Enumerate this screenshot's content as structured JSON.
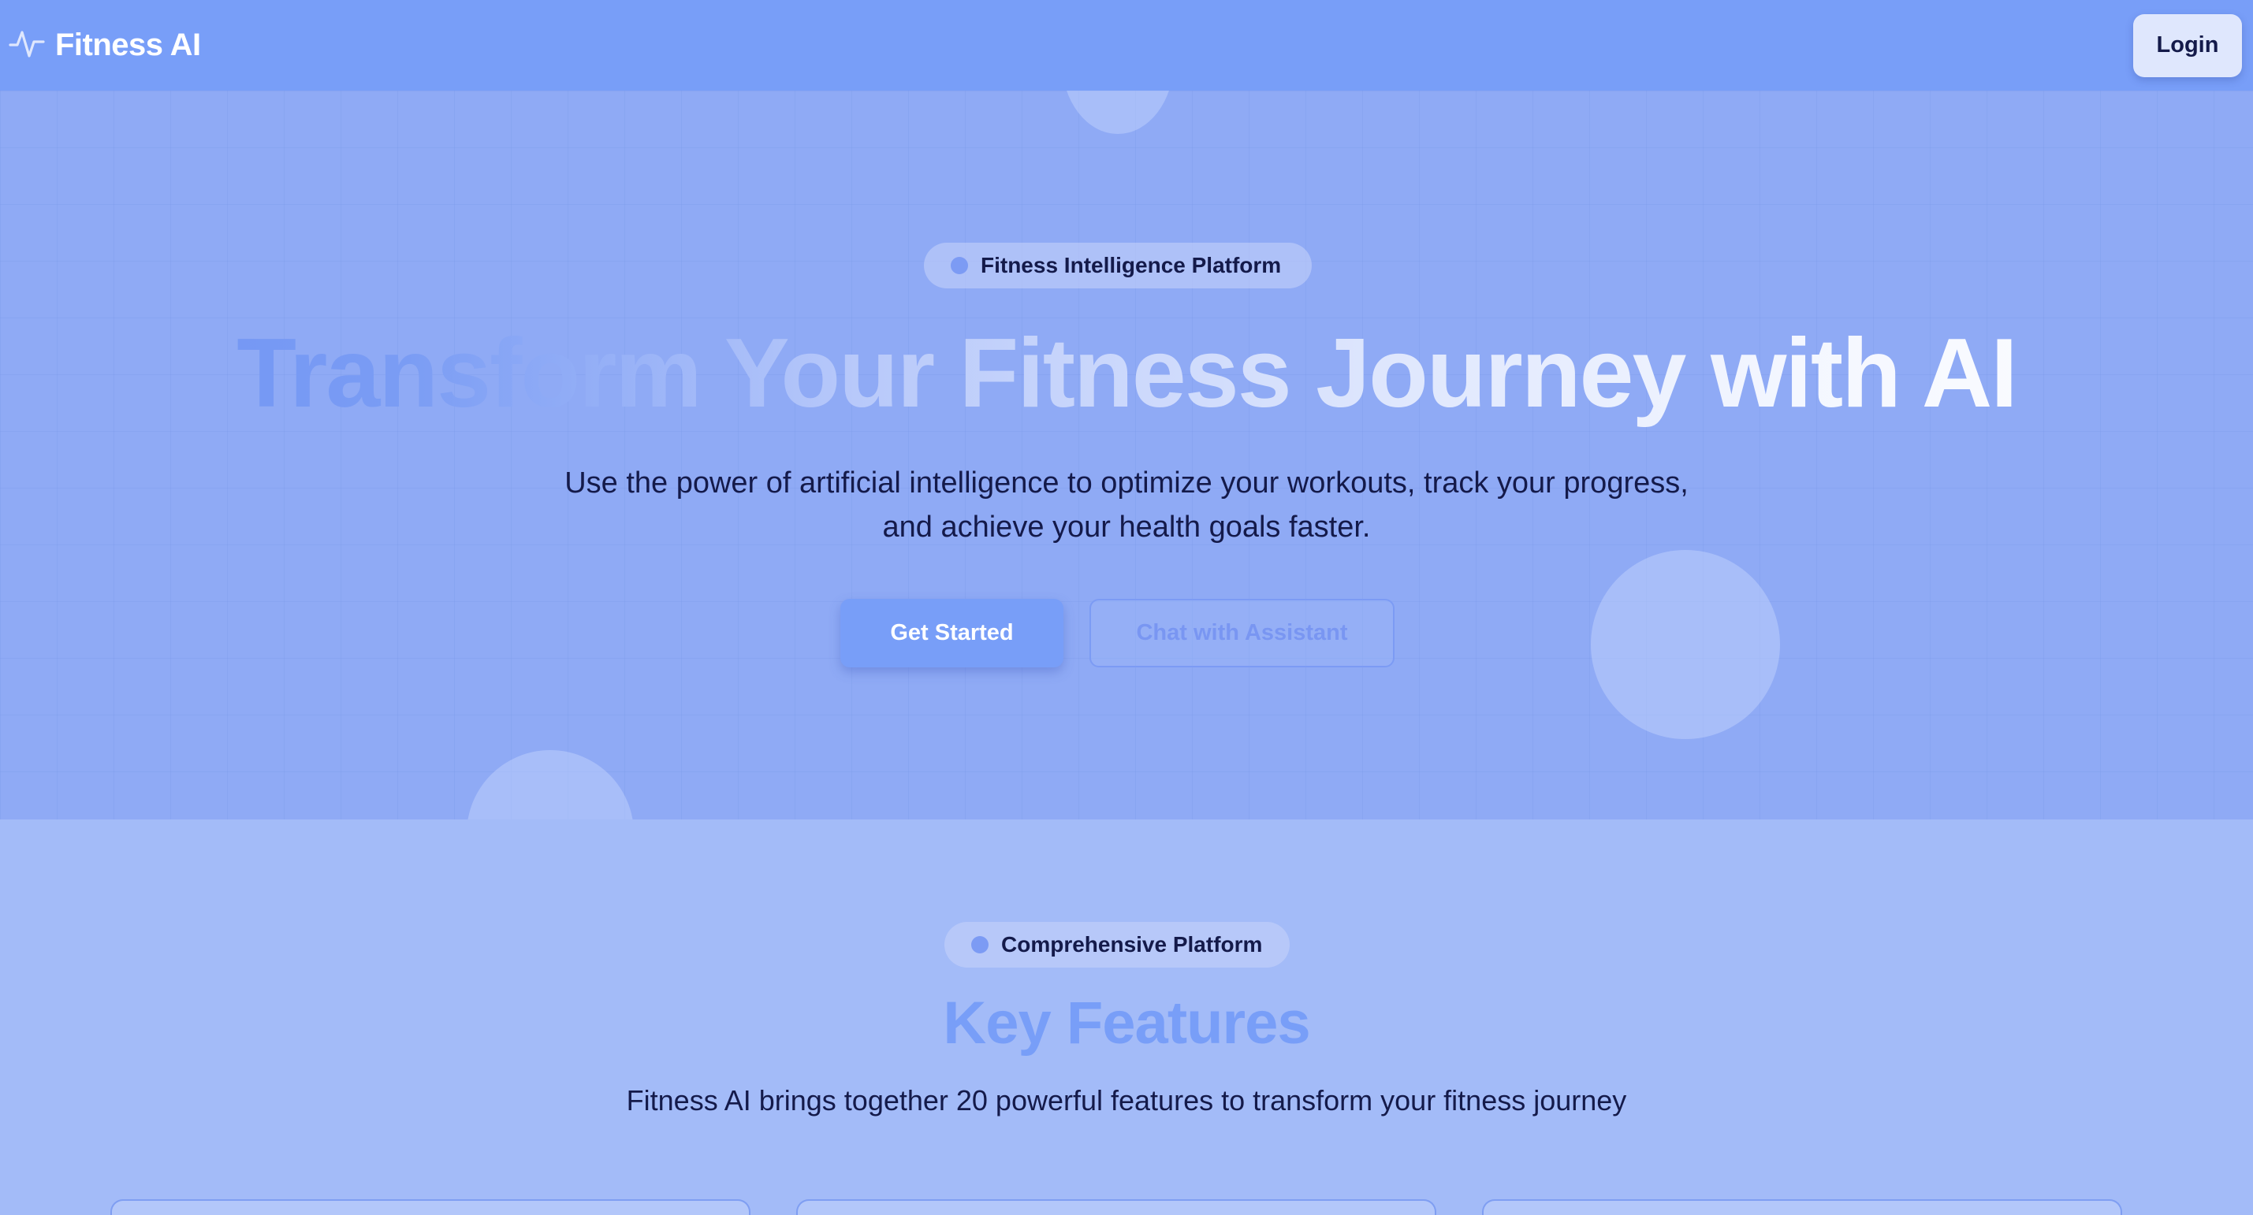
{
  "navbar": {
    "brand_icon": "activity-pulse-icon",
    "brand_name": "Fitness AI",
    "login_label": "Login"
  },
  "hero": {
    "badge": "Fitness Intelligence Platform",
    "title": "Transform Your Fitness Journey with AI",
    "subtitle_line1": "Use the power of artificial intelligence to optimize your workouts, track your progress,",
    "subtitle_line2": "and achieve your health goals faster.",
    "primary_button": "Get Started",
    "secondary_button": "Chat with Assistant"
  },
  "features": {
    "badge": "Comprehensive Platform",
    "title": "Key Features",
    "subtitle": "Fitness AI brings together 20 powerful features to transform your fitness journey"
  },
  "colors": {
    "accent": "#789ef8",
    "navbar_bg": "#789ef8",
    "hero_bg": "#8faaf5",
    "features_bg": "#a3bbf8",
    "text_dark": "#141a4a"
  }
}
